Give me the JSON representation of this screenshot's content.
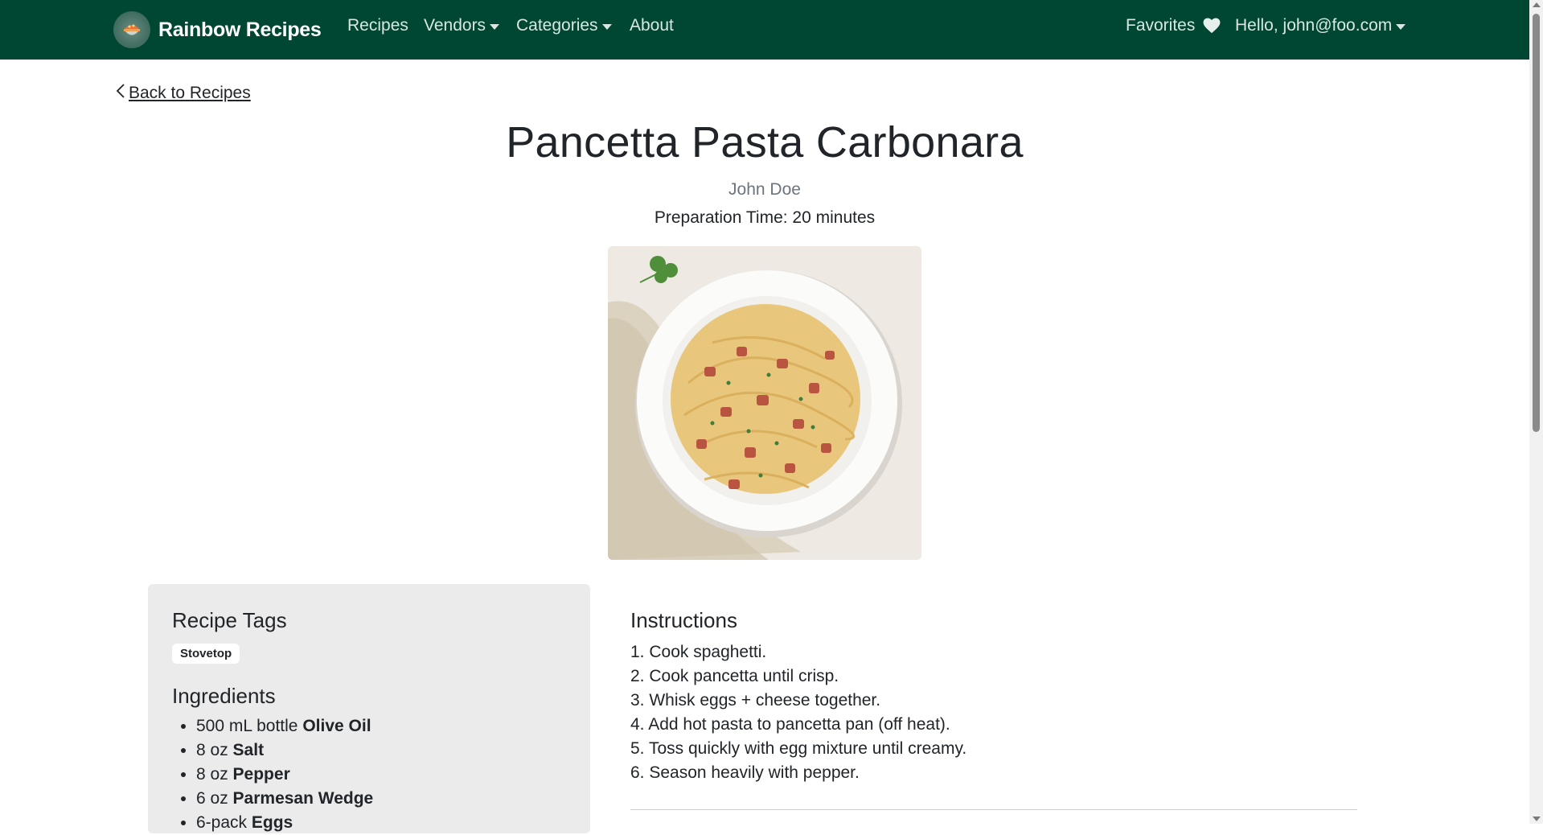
{
  "navbar": {
    "brand": "Rainbow Recipes",
    "links": {
      "recipes": "Recipes",
      "vendors": "Vendors",
      "categories": "Categories",
      "about": "About"
    },
    "favorites": "Favorites",
    "user": "Hello, john@foo.com",
    "bg_color": "#004733"
  },
  "page": {
    "back_link": "Back to Recipes",
    "title": "Pancetta Pasta Carbonara",
    "author": "John Doe",
    "prep_time": "Preparation Time: 20 minutes",
    "image_alt": "Pancetta pasta carbonara in a white bowl"
  },
  "sidebar": {
    "tags_heading": "Recipe Tags",
    "tags": [
      "Stovetop"
    ],
    "ingredients_heading": "Ingredients",
    "ingredients": [
      {
        "qty": "500 mL bottle",
        "name": "Olive Oil"
      },
      {
        "qty": "8 oz",
        "name": "Salt"
      },
      {
        "qty": "8 oz",
        "name": "Pepper"
      },
      {
        "qty": "6 oz",
        "name": "Parmesan Wedge"
      },
      {
        "qty": "6-pack",
        "name": "Eggs"
      }
    ]
  },
  "instructions": {
    "heading": "Instructions",
    "steps": [
      "1. Cook spaghetti.",
      "2. Cook pancetta until crisp.",
      "3. Whisk eggs + cheese together.",
      "4. Add hot pasta to pancetta pan (off heat).",
      "5. Toss quickly with egg mixture until creamy.",
      "6. Season heavily with pepper."
    ]
  }
}
